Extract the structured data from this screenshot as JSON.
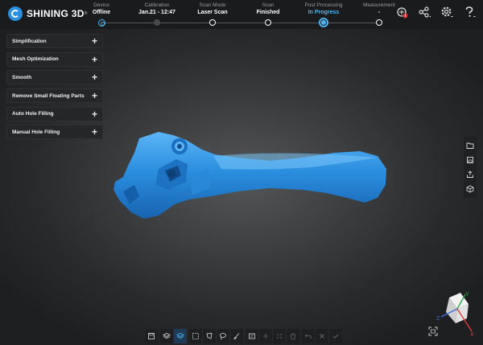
{
  "app": {
    "brand": "SHINING 3D",
    "brand_mark": "®"
  },
  "steps": [
    {
      "label": "Device",
      "value": "Offline",
      "state": "first"
    },
    {
      "label": "Calibration",
      "value": "Jan.21 - 12:47",
      "state": "done"
    },
    {
      "label": "Scan Mode",
      "value": "Laser Scan",
      "state": "normal"
    },
    {
      "label": "Scan",
      "value": "Finished",
      "state": "normal"
    },
    {
      "label": "Post Processing",
      "value": "In Progress",
      "state": "current"
    },
    {
      "label": "Measurement",
      "value": "-",
      "state": "normal"
    }
  ],
  "top_icons": [
    "texture-warning-icon",
    "share-icon",
    "settings-icon",
    "help-icon"
  ],
  "panel": {
    "items": [
      {
        "label": "Simplification"
      },
      {
        "label": "Mesh Optimization"
      },
      {
        "label": "Smooth"
      },
      {
        "label": "Remove Small Floating Parts"
      },
      {
        "label": "Auto Hole Filling"
      },
      {
        "label": "Manual Hole Filling"
      }
    ],
    "plus": "+"
  },
  "right_toolbar": [
    "folder-icon",
    "save-icon",
    "export-icon",
    "cube-icon"
  ],
  "bottom_toolbar": {
    "groups": [
      [
        "save-project-icon"
      ],
      [
        "layers-icon",
        "layers-active-icon"
      ],
      [
        "rect-select-icon",
        "polygon-select-icon",
        "lasso-select-icon",
        "brush-select-icon"
      ],
      [
        "select-all-icon",
        "invert-select-icon",
        "select-connected-icon",
        "delete-icon"
      ],
      [
        "undo-icon",
        "cancel-icon",
        "confirm-icon"
      ]
    ]
  },
  "axis_labels": {
    "x": "X",
    "y": "Y",
    "z": "Z"
  },
  "colors": {
    "accent": "#4fb4f0",
    "model": "#2b8fe0",
    "panel": "#252628"
  }
}
